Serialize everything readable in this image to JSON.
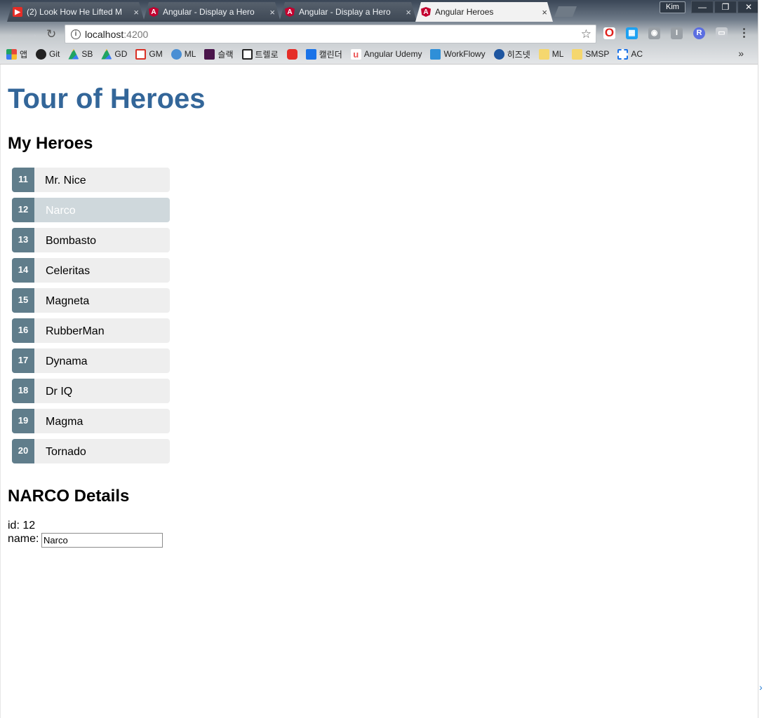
{
  "browser": {
    "tabs": [
      {
        "title": "(2) Look How He Lifted M",
        "favicon": "youtube-icon",
        "active": false
      },
      {
        "title": "Angular - Display a Hero",
        "favicon": "angular-icon",
        "active": false
      },
      {
        "title": "Angular - Display a Hero",
        "favicon": "angular-icon",
        "active": false
      },
      {
        "title": "Angular Heroes",
        "favicon": "angular-icon",
        "active": true
      }
    ],
    "close_glyph": "×",
    "profile_name": "Kim",
    "window_buttons": [
      "—",
      "❐",
      "✕"
    ],
    "url_host": "localhost",
    "url_port": ":4200",
    "bookmarks": [
      {
        "label": "앱",
        "icon": "apps-icon",
        "color": "#e8453c"
      },
      {
        "label": "Git",
        "icon": "github-icon",
        "color": "#222222"
      },
      {
        "label": "SB",
        "icon": "drive-icon",
        "color": "#1fa463"
      },
      {
        "label": "GD",
        "icon": "drive-icon",
        "color": "#1fa463"
      },
      {
        "label": "GM",
        "icon": "gmail-icon",
        "color": "#d93025"
      },
      {
        "label": "ML",
        "icon": "link-icon",
        "color": "#4a8fd4"
      },
      {
        "label": "슬랙",
        "icon": "slack-icon",
        "color": "#4a154b"
      },
      {
        "label": "트렐로",
        "icon": "trello-icon",
        "color": "#222222"
      },
      {
        "label": "",
        "icon": "youtube-icon",
        "color": "#e52d27"
      },
      {
        "label": "캘린더",
        "icon": "calendar-icon",
        "color": "#1a73e8"
      },
      {
        "label": "Angular Udemy",
        "icon": "udemy-icon",
        "color": "#ec5252"
      },
      {
        "label": "WorkFlowy",
        "icon": "workflowy-icon",
        "color": "#2f8fd8"
      },
      {
        "label": "히즈넷",
        "icon": "hisnet-icon",
        "color": "#1e56a0"
      },
      {
        "label": "ML",
        "icon": "folder-icon",
        "color": "#f5d76e"
      },
      {
        "label": "SMSP",
        "icon": "folder-icon",
        "color": "#f5d76e"
      },
      {
        "label": "AC",
        "icon": "play-icon",
        "color": "#1a73e8"
      }
    ],
    "bookmarks_more": "»"
  },
  "app": {
    "title": "Tour of Heroes",
    "list_heading": "My Heroes",
    "heroes": [
      {
        "id": "11",
        "name": "Mr. Nice"
      },
      {
        "id": "12",
        "name": "Narco"
      },
      {
        "id": "13",
        "name": "Bombasto"
      },
      {
        "id": "14",
        "name": "Celeritas"
      },
      {
        "id": "15",
        "name": "Magneta"
      },
      {
        "id": "16",
        "name": "RubberMan"
      },
      {
        "id": "17",
        "name": "Dynama"
      },
      {
        "id": "18",
        "name": "Dr IQ"
      },
      {
        "id": "19",
        "name": "Magma"
      },
      {
        "id": "20",
        "name": "Tornado"
      }
    ],
    "selected_hero_id": "12",
    "details": {
      "heading": "NARCO Details",
      "id_line": "id: 12",
      "name_label": "name:",
      "name_value": "Narco"
    }
  },
  "colors": {
    "title": "#336699",
    "badge": "#607d8b",
    "item_bg": "#eeeeee",
    "selected_bg": "#cfd8dc"
  }
}
